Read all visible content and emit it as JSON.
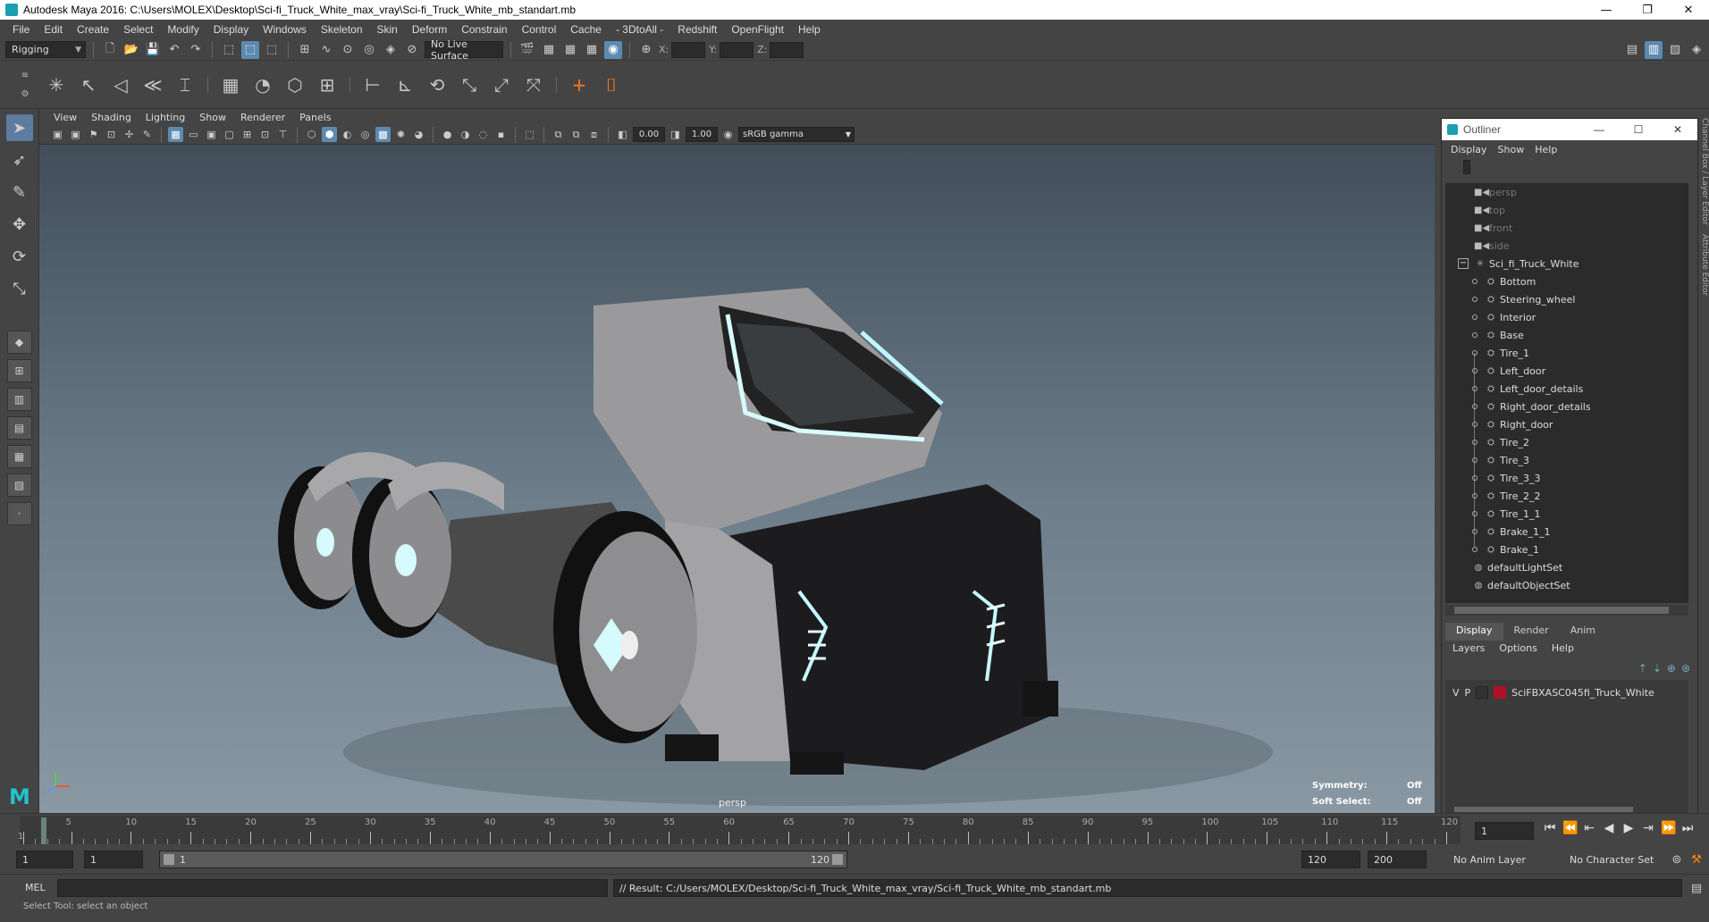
{
  "window": {
    "title": "Autodesk Maya 2016: C:\\Users\\MOLEX\\Desktop\\Sci-fi_Truck_White_max_vray\\Sci-fi_Truck_White_mb_standart.mb",
    "controls": [
      "—",
      "❐",
      "✕"
    ]
  },
  "menubar": [
    "File",
    "Edit",
    "Create",
    "Select",
    "Modify",
    "Display",
    "Windows",
    "Skeleton",
    "Skin",
    "Deform",
    "Constrain",
    "Control",
    "Cache",
    "- 3DtoAll -",
    "Redshift",
    "OpenFlight",
    "Help"
  ],
  "statusline": {
    "menuset": "Rigging",
    "live_surface": "No Live Surface",
    "coord_labels": [
      "X:",
      "Y:",
      "Z:"
    ]
  },
  "viewport": {
    "menus": [
      "View",
      "Shading",
      "Lighting",
      "Show",
      "Renderer",
      "Panels"
    ],
    "exposure": "0.00",
    "gamma": "1.00",
    "color_space": "sRGB gamma",
    "camera": "persp",
    "symmetry_label": "Symmetry:",
    "symmetry_value": "Off",
    "soft_select_label": "Soft Select:",
    "soft_select_value": "Off"
  },
  "outliner": {
    "title": "Outliner",
    "menus": [
      "Display",
      "Show",
      "Help"
    ],
    "cameras": [
      "persp",
      "top",
      "front",
      "side"
    ],
    "root": "Sci_fi_Truck_White",
    "children": [
      "Bottom",
      "Steering_wheel",
      "Interior",
      "Base",
      "Tire_1",
      "Left_door",
      "Left_door_details",
      "Right_door_details",
      "Right_door",
      "Tire_2",
      "Tire_3",
      "Tire_3_3",
      "Tire_2_2",
      "Tire_1_1",
      "Brake_1_1",
      "Brake_1"
    ],
    "sets": [
      "defaultLightSet",
      "defaultObjectSet"
    ]
  },
  "layers": {
    "tabs": [
      "Display",
      "Render",
      "Anim"
    ],
    "menus": [
      "Layers",
      "Options",
      "Help"
    ],
    "row": {
      "v": "V",
      "p": "P",
      "name": "SciFBXASC045fi_Truck_White",
      "color": "#b0102a"
    }
  },
  "side_tabs": [
    "Channel Box / Layer Editor",
    "Attribute Editor"
  ],
  "timeline": {
    "ticks": [
      "1",
      "5",
      "10",
      "15",
      "20",
      "25",
      "30",
      "35",
      "40",
      "45",
      "50",
      "55",
      "60",
      "65",
      "70",
      "75",
      "80",
      "85",
      "90",
      "95",
      "100",
      "105",
      "110",
      "115",
      "120"
    ],
    "current_frame": "1",
    "current_time": 1,
    "max_frame": 120
  },
  "range": {
    "start": "1",
    "playback_start": "1",
    "slider_start": "1",
    "slider_end": "120",
    "playback_end": "120",
    "end": "200",
    "anim_layer": "No Anim Layer",
    "character_set": "No Character Set"
  },
  "command": {
    "lang": "MEL",
    "result": "// Result: C:/Users/MOLEX/Desktop/Sci-fi_Truck_White_max_vray/Sci-fi_Truck_White_mb_standart.mb",
    "help": "Select Tool: select an object"
  }
}
